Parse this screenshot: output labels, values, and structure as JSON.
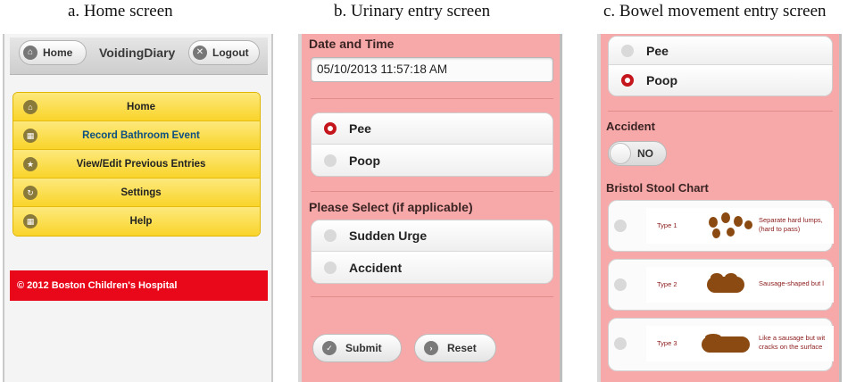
{
  "captions": {
    "a": "a. Home screen",
    "b": "b. Urinary entry screen",
    "c": "c. Bowel movement entry screen"
  },
  "home": {
    "header": {
      "home_btn": "Home",
      "title": "VoidingDiary",
      "logout_btn": "Logout"
    },
    "menu": [
      {
        "label": "Home",
        "icon": "home-icon"
      },
      {
        "label": "Record Bathroom Event",
        "icon": "grid-icon",
        "active": true
      },
      {
        "label": "View/Edit Previous Entries",
        "icon": "star-icon"
      },
      {
        "label": "Settings",
        "icon": "refresh-icon"
      },
      {
        "label": "Help",
        "icon": "grid-icon"
      }
    ],
    "footer": "© 2012 Boston Children's Hospital"
  },
  "urinary": {
    "date_label": "Date and Time",
    "date_value": "05/10/2013 11:57:18 AM",
    "type_options": [
      {
        "label": "Pee",
        "selected": true
      },
      {
        "label": "Poop",
        "selected": false
      }
    ],
    "select_label": "Please Select (if applicable)",
    "extra_options": [
      {
        "label": "Sudden Urge",
        "selected": false
      },
      {
        "label": "Accident",
        "selected": false
      }
    ],
    "submit": "Submit",
    "reset": "Reset"
  },
  "bowel": {
    "type_options": [
      {
        "label": "Pee",
        "selected": false
      },
      {
        "label": "Poop",
        "selected": true
      }
    ],
    "accident_label": "Accident",
    "accident_toggle": "NO",
    "bristol_label": "Bristol Stool Chart",
    "bristol": [
      {
        "type": "Type 1",
        "desc1": "Separate hard lumps,",
        "desc2": "(hard to pass)"
      },
      {
        "type": "Type 2",
        "desc1": "Sausage-shaped but l",
        "desc2": ""
      },
      {
        "type": "Type 3",
        "desc1": "Like a sausage but wit",
        "desc2": "cracks on the surface"
      }
    ]
  },
  "colors": {
    "pink_bg": "#f7a8a8",
    "menu_yellow": "#f9d42a",
    "footer_red": "#e8081a",
    "radio_red": "#c4161c"
  }
}
